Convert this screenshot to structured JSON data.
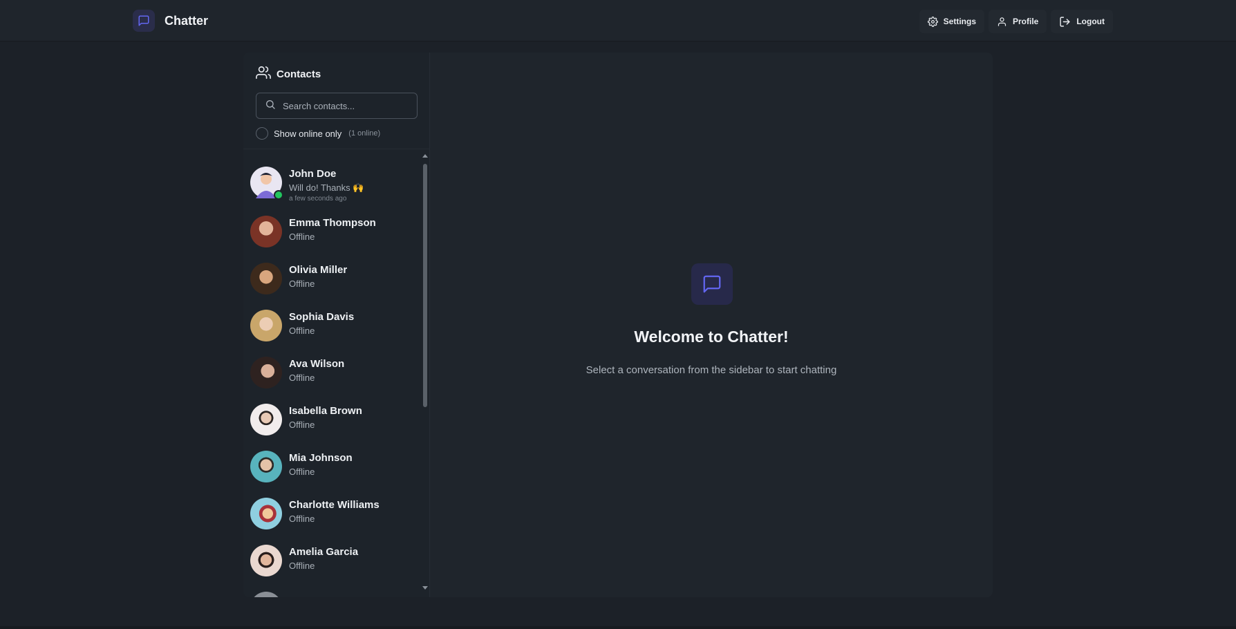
{
  "header": {
    "app_name": "Chatter",
    "logo_icon": "message-square-icon",
    "nav": [
      {
        "label": "Settings",
        "icon": "gear-icon"
      },
      {
        "label": "Profile",
        "icon": "user-icon"
      },
      {
        "label": "Logout",
        "icon": "logout-icon"
      }
    ]
  },
  "sidebar": {
    "title": "Contacts",
    "title_icon": "users-icon",
    "search": {
      "placeholder": "Search contacts...",
      "value": ""
    },
    "online_filter": {
      "label": "Show online only",
      "count_text": "(1 online)",
      "checked": false
    },
    "contacts": [
      {
        "name": "John Doe",
        "subtitle": "Will do! Thanks 🙌",
        "time": "a few seconds ago",
        "online": true,
        "avatar_color": "#e9e6f2"
      },
      {
        "name": "Emma Thompson",
        "subtitle": "Offline",
        "online": false,
        "avatar_color": "#8a4a3a"
      },
      {
        "name": "Olivia Miller",
        "subtitle": "Offline",
        "online": false,
        "avatar_color": "#6b5a3a"
      },
      {
        "name": "Sophia Davis",
        "subtitle": "Offline",
        "online": false,
        "avatar_color": "#c9b07a"
      },
      {
        "name": "Ava Wilson",
        "subtitle": "Offline",
        "online": false,
        "avatar_color": "#4a3a33"
      },
      {
        "name": "Isabella Brown",
        "subtitle": "Offline",
        "online": false,
        "avatar_color": "#f0ecec"
      },
      {
        "name": "Mia Johnson",
        "subtitle": "Offline",
        "online": false,
        "avatar_color": "#4aa3b0"
      },
      {
        "name": "Charlotte Williams",
        "subtitle": "Offline",
        "online": false,
        "avatar_color": "#d08a5a"
      },
      {
        "name": "Amelia Garcia",
        "subtitle": "Offline",
        "online": false,
        "avatar_color": "#e8d8d0"
      }
    ]
  },
  "welcome": {
    "icon": "message-square-icon",
    "title": "Welcome to Chatter!",
    "subtitle": "Select a conversation from the sidebar to start chatting"
  },
  "colors": {
    "accent": "#6366f1",
    "online": "#22c55e",
    "background": "#1c2128",
    "panel": "#1f252c"
  }
}
